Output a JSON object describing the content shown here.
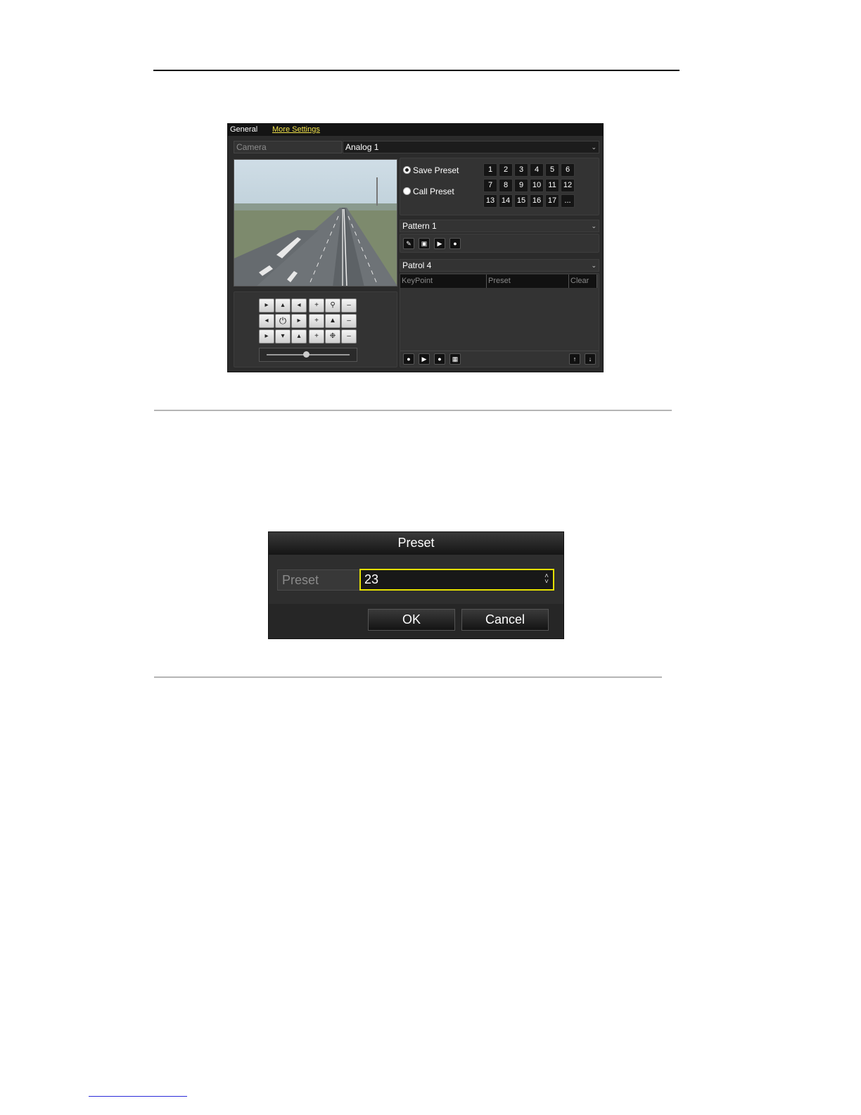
{
  "ptz_panel": {
    "tabs": [
      "General",
      "More Settings"
    ],
    "camera_label": "Camera",
    "camera_value": "Analog 1",
    "preset_options": {
      "save": "Save Preset",
      "call": "Call Preset"
    },
    "preset_numbers": [
      "1",
      "2",
      "3",
      "4",
      "5",
      "6",
      "7",
      "8",
      "9",
      "10",
      "11",
      "12",
      "13",
      "14",
      "15",
      "16",
      "17",
      "..."
    ],
    "pattern_value": "Pattern 1",
    "patrol_value": "Patrol 4",
    "patrol_table_headers": [
      "KeyPoint",
      "Preset",
      "Clear"
    ]
  },
  "preset_dialog": {
    "title": "Preset",
    "field_label": "Preset",
    "field_value": "23",
    "ok_label": "OK",
    "cancel_label": "Cancel"
  },
  "colors": {
    "accent_yellow": "#e5e000",
    "tab_link": "#f2e34b"
  }
}
